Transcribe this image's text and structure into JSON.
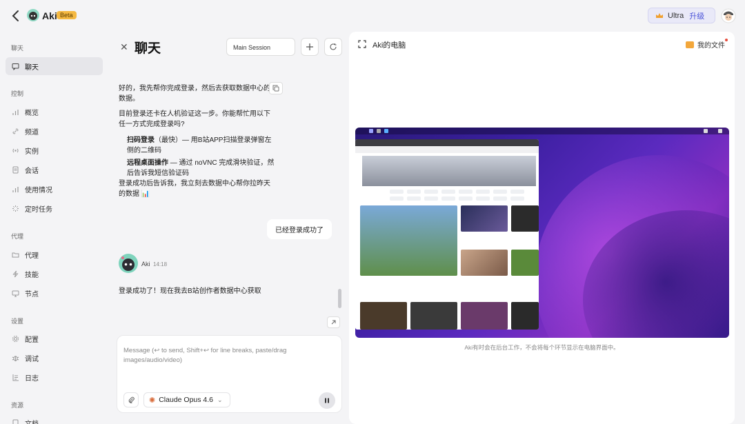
{
  "app": {
    "title": "Aki",
    "badge": "Beta",
    "plan": "Ultra",
    "upgrade": "升级"
  },
  "sidebar": {
    "sections": [
      {
        "label": "聊天",
        "items": [
          {
            "label": "聊天",
            "icon": "chat-icon",
            "active": true
          }
        ]
      },
      {
        "label": "控制",
        "items": [
          {
            "label": "概览",
            "icon": "chart-bar-icon"
          },
          {
            "label": "频道",
            "icon": "link-icon"
          },
          {
            "label": "实例",
            "icon": "radio-icon"
          },
          {
            "label": "会话",
            "icon": "document-icon"
          },
          {
            "label": "使用情况",
            "icon": "chart-bar-icon"
          },
          {
            "label": "定时任务",
            "icon": "loader-icon"
          }
        ]
      },
      {
        "label": "代理",
        "items": [
          {
            "label": "代理",
            "icon": "folder-icon"
          },
          {
            "label": "技能",
            "icon": "bolt-icon"
          },
          {
            "label": "节点",
            "icon": "monitor-icon"
          }
        ]
      },
      {
        "label": "设置",
        "items": [
          {
            "label": "配置",
            "icon": "gear-icon"
          },
          {
            "label": "调试",
            "icon": "bug-icon"
          },
          {
            "label": "日志",
            "icon": "log-icon"
          }
        ]
      },
      {
        "label": "资源",
        "items": [
          {
            "label": "文档",
            "icon": "book-icon"
          }
        ]
      }
    ]
  },
  "chat": {
    "title": "聊天",
    "session": "Main Session",
    "messages": {
      "m1_line1": "好的，我先帮你完成登录，然后去获取数据中心的",
      "m1_line2": "数据。",
      "m2_line1": "目前登录还卡在人机验证这一步。你能帮忙用以下",
      "m2_line2": "任一方式完成登录吗?",
      "opt1_bold": "扫码登录",
      "opt1_rest": "（最快）— 用B站APP扫描登录弹窗左",
      "opt1_line2": "侧的二维码",
      "opt2_bold": "远程桌面操作",
      "opt2_rest": " — 通过 noVNC 完成滑块验证，然",
      "opt2_line2": "后告诉我短信验证码",
      "m3_line1": "登录成功后告诉我，我立刻去数据中心帮你拉昨天",
      "m3_line2": "的数据 📊",
      "user_msg": "已经登录成功了",
      "aki_name": "Aki",
      "aki_time": "14:18",
      "m4": "登录成功了！现在我去B站创作者数据中心获取"
    },
    "input": {
      "placeholder_line1": "Message (↩ to send, Shift+↩ for line breaks, paste/drag",
      "placeholder_line2": "images/audio/video)"
    },
    "model": "Claude Opus 4.6"
  },
  "computer": {
    "title": "Aki的电脑",
    "files": "我的文件",
    "caption": "Aki有时会在后台工作，不会将每个环节显示在电脑界面中。"
  }
}
